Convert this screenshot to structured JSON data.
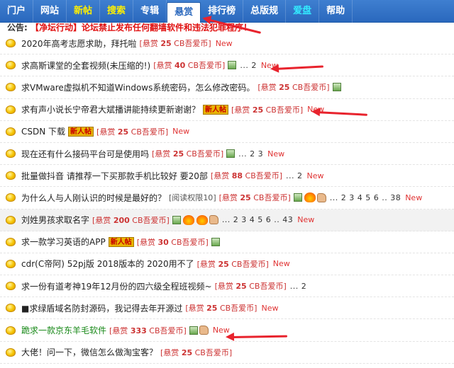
{
  "nav": {
    "items": [
      {
        "label": "门户",
        "style": "normal"
      },
      {
        "label": "网站",
        "style": "normal"
      },
      {
        "label": "新帖",
        "style": "hl"
      },
      {
        "label": "搜索",
        "style": "hl"
      },
      {
        "label": "专辑",
        "style": "normal"
      },
      {
        "label": "悬赏",
        "style": "active"
      },
      {
        "label": "排行榜",
        "style": "normal"
      },
      {
        "label": "总版规",
        "style": "normal"
      },
      {
        "label": "爱盘",
        "style": "cyan"
      },
      {
        "label": "帮助",
        "style": "normal"
      }
    ]
  },
  "notice": {
    "prefix": "公告:",
    "text": "【净坛行动】论坛禁止发布任何翻墙软件和违法犯罪程序！"
  },
  "threads": [
    {
      "title": "2020年高考志愿求助，拜托啦",
      "bounty_pre": "[悬赏",
      "amount": "25",
      "bounty_post": "CB吾爱币]",
      "new": "New"
    },
    {
      "title": "求高斯课堂的全套视频(未压缩的!)",
      "bounty_pre": "[悬赏",
      "amount": "40",
      "bounty_post": "CB吾爱币]",
      "img": true,
      "pages": "... 2",
      "new": "New"
    },
    {
      "title": "求VMware虚拟机不知道Windows系统密码，怎么修改密码。",
      "bounty_pre": "[悬赏",
      "amount": "25",
      "bounty_post": "CB吾爱币]",
      "img": true
    },
    {
      "title": "求有声小说长宁帝君大斌播讲能持续更新谢谢？",
      "newbie": "新人帖",
      "bounty_pre": "[悬赏",
      "amount": "25",
      "bounty_post": "CB吾爱币]",
      "new": "New"
    },
    {
      "title": "CSDN 下载",
      "newbie": "新人帖",
      "bounty_pre": "[悬赏",
      "amount": "25",
      "bounty_post": "CB吾爱币]",
      "new": "New"
    },
    {
      "title": "现在还有什么接码平台可是使用吗",
      "bounty_pre": "[悬赏",
      "amount": "25",
      "bounty_post": "CB吾爱币]",
      "img": true,
      "pages": "... 2 3",
      "new": "New"
    },
    {
      "title": "批量做抖音 请推荐一下买那款手机比较好 要20部",
      "bounty_pre": "[悬赏",
      "amount": "88",
      "bounty_post": "CB吾爱币]",
      "pages": "... 2",
      "new": "New"
    },
    {
      "title": "为什么人与人刚认识的时候是最好的？",
      "extra_pre": "[阅读权限",
      "extra_val": "10",
      "extra_post": "]",
      "bounty_pre": "[悬赏",
      "amount": "25",
      "bounty_post": "CB吾爱币]",
      "img": true,
      "fire": true,
      "thumb": true,
      "pages": "... 2 3 4 5 6 .. 38",
      "new": "New"
    },
    {
      "title": "刘姓男孩求取名字",
      "bounty_pre": "[悬赏",
      "amount": "200",
      "bounty_post": "CB吾爱币]",
      "img": true,
      "fire": true,
      "fire2": true,
      "thumb": true,
      "pages": "... 2 3 4 5 6 .. 43",
      "new": "New",
      "shaded": true
    },
    {
      "title": "求一款学习英语的APP",
      "newbie": "新人帖",
      "bounty_pre": "[悬赏",
      "amount": "30",
      "bounty_post": "CB吾爱币]",
      "img": true
    },
    {
      "title": "cdr(C帝阿) 52pj版 2018版本的 2020用不了",
      "bounty_pre": "[悬赏",
      "amount": "25",
      "bounty_post": "CB吾爱币]",
      "new": "New"
    },
    {
      "title": "求一份有道考神19年12月份的四六级全程班视频~",
      "bounty_pre": "[悬赏",
      "amount": "25",
      "bounty_post": "CB吾爱币]",
      "pages": "... 2"
    },
    {
      "title": "■求绿盾域名防封源码，我记得去年开源过",
      "bounty_pre": "[悬赏",
      "amount": "25",
      "bounty_post": "CB吾爱币]",
      "new": "New"
    },
    {
      "title": "跪求一款京东羊毛软件",
      "green": true,
      "bounty_pre": "[悬赏",
      "amount": "333",
      "bounty_post": "CB吾爱币]",
      "img": true,
      "thumb": true,
      "new": "New"
    },
    {
      "title": "大佬！问一下，微信怎么做淘宝客？",
      "bounty_pre": "[悬赏",
      "amount": "25",
      "bounty_post": "CB吾爱币]"
    }
  ],
  "colors": {
    "nav_bg": "#2a68bd",
    "bounty": "#cc3333",
    "arrow": "#e8232d",
    "highlight_nav": "#ffef00"
  }
}
